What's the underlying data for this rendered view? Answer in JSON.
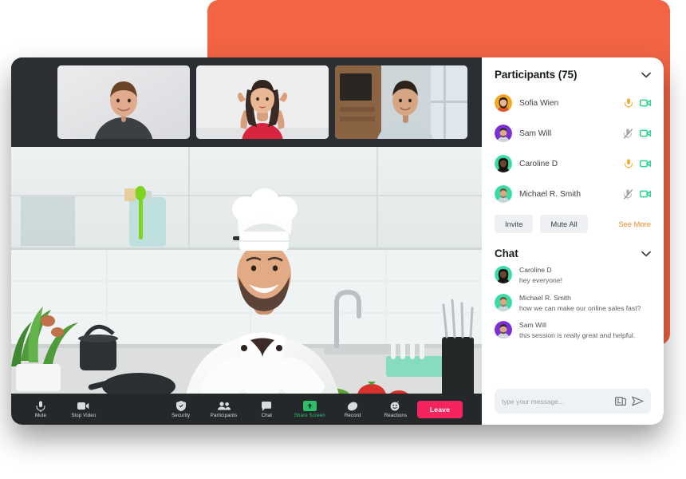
{
  "theme": {
    "accent_orange": "#F26443",
    "leave_red": "#F5245E",
    "share_green": "#2EBD6B",
    "see_more_orange": "#F08C2A",
    "mic_on_yellow": "#F5A623",
    "mic_off_grey": "#9aa1a6",
    "camera_green": "#2DD48F",
    "panel_bg": "#FFFFFF",
    "frame_dark": "#24282B"
  },
  "filmstrip": {
    "thumbnails": [
      {
        "name": "participant-thumbnail-1",
        "alt": "Young man in dark grey henley shirt smiling",
        "bg": "#e3e4e6"
      },
      {
        "name": "participant-thumbnail-2",
        "alt": "Woman in red top with hands raised smiling",
        "bg": "#e9e9ea"
      },
      {
        "name": "participant-thumbnail-3",
        "alt": "Man in light denim shirt in office with windows",
        "bg": "#8a6b4e"
      }
    ]
  },
  "main_video": {
    "alt": "Chef in white uniform and toque gesturing in a bright modern kitchen",
    "speaker_role": "chef"
  },
  "toolbar": {
    "items": [
      {
        "label": "Mute",
        "icon": "microphone-icon",
        "state": "default"
      },
      {
        "label": "Stop Video",
        "icon": "video-camera-icon",
        "state": "default"
      },
      {
        "label": "Security",
        "icon": "shield-check-icon",
        "state": "default"
      },
      {
        "label": "Participants",
        "icon": "people-icon",
        "state": "default"
      },
      {
        "label": "Chat",
        "icon": "chat-bubble-icon",
        "state": "default"
      },
      {
        "label": "Share Screen",
        "icon": "share-screen-icon",
        "state": "active"
      },
      {
        "label": "Record",
        "icon": "record-icon",
        "state": "default"
      },
      {
        "label": "Reactions",
        "icon": "smiley-reactions-icon",
        "state": "default"
      }
    ],
    "leave_label": "Leave"
  },
  "participants_panel": {
    "title": "Participants (75)",
    "collapse_icon": "chevron-down-icon",
    "list": [
      {
        "name": "Sofia Wien",
        "avatar_bg": "#F5A623",
        "mic": "on",
        "camera": "on"
      },
      {
        "name": "Sam Will",
        "avatar_bg": "#7B2FD6",
        "mic": "off",
        "camera": "on"
      },
      {
        "name": "Caroline D",
        "avatar_bg": "#3BDBA4",
        "mic": "on",
        "camera": "on"
      },
      {
        "name": "Michael R. Smith",
        "avatar_bg": "#3BDBA4",
        "mic": "off",
        "camera": "on"
      }
    ],
    "invite_label": "Invite",
    "mute_all_label": "Mute All",
    "see_more_label": "See More"
  },
  "chat_panel": {
    "title": "Chat",
    "collapse_icon": "chevron-down-icon",
    "messages": [
      {
        "author": "Caroline D",
        "text": "hey everyone!",
        "avatar_bg": "#3BDBA4"
      },
      {
        "author": "Michael R. Smith",
        "text": "how we can make our online sales fast?",
        "avatar_bg": "#3BDBA4"
      },
      {
        "author": "Sam Will",
        "text": "this session is really great and helpful.",
        "avatar_bg": "#7B2FD6"
      }
    ],
    "composer": {
      "placeholder": "type your message...",
      "value": "",
      "attach_icon": "document-attach-icon",
      "send_icon": "send-arrow-icon"
    }
  }
}
